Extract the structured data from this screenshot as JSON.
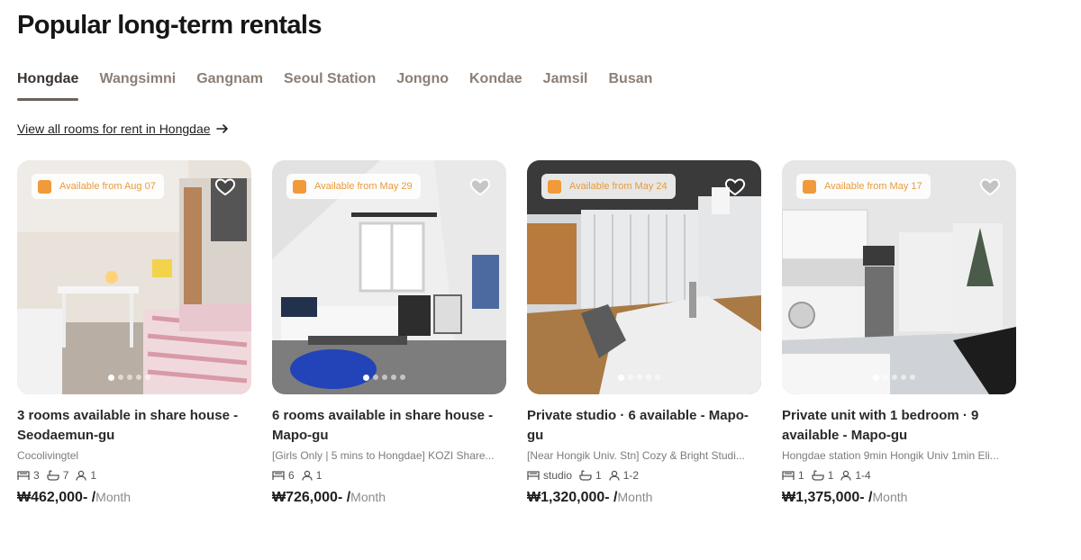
{
  "page": {
    "title": "Popular long-term rentals"
  },
  "tabs": [
    {
      "label": "Hongdae",
      "active": true
    },
    {
      "label": "Wangsimni"
    },
    {
      "label": "Gangnam"
    },
    {
      "label": "Seoul Station"
    },
    {
      "label": "Jongno"
    },
    {
      "label": "Kondae"
    },
    {
      "label": "Jamsil"
    },
    {
      "label": "Busan"
    }
  ],
  "view_all": {
    "label": "View all rooms for rent in Hongdae",
    "icon": "arrow-right-icon"
  },
  "colors": {
    "accent": "#f09a3a",
    "tab_active": "#3a3430",
    "tab_inactive": "#8b7f76"
  },
  "listings": [
    {
      "available": "Available from Aug 07",
      "title": "3 rooms available in share house - Seodaemun-gu",
      "subtitle": "Cocolivingtel",
      "meta": {
        "rooms": "3",
        "baths": "7",
        "guests": "1"
      },
      "price": "₩462,000-",
      "per": "Month"
    },
    {
      "available": "Available from May 29",
      "title": "6 rooms available in share house - Mapo-gu",
      "subtitle": "[Girls Only | 5 mins to Hongdae] KOZI Share...",
      "meta": {
        "rooms": "6",
        "guests": "1"
      },
      "price": "₩726,000-",
      "per": "Month"
    },
    {
      "available": "Available from May 24",
      "title": "Private studio · 6 available - Mapo-gu",
      "subtitle": "[Near Hongik Univ. Stn] Cozy & Bright Studi...",
      "meta": {
        "rooms": "studio",
        "baths": "1",
        "guests": "1-2"
      },
      "price": "₩1,320,000-",
      "per": "Month"
    },
    {
      "available": "Available from May 17",
      "title": "Private unit with 1 bedroom · 9 available - Mapo-gu",
      "subtitle": "Hongdae station 9min Hongik Univ 1min Eli...",
      "meta": {
        "rooms": "1",
        "baths": "1",
        "guests": "1-4"
      },
      "price": "₩1,375,000-",
      "per": "Month"
    }
  ]
}
